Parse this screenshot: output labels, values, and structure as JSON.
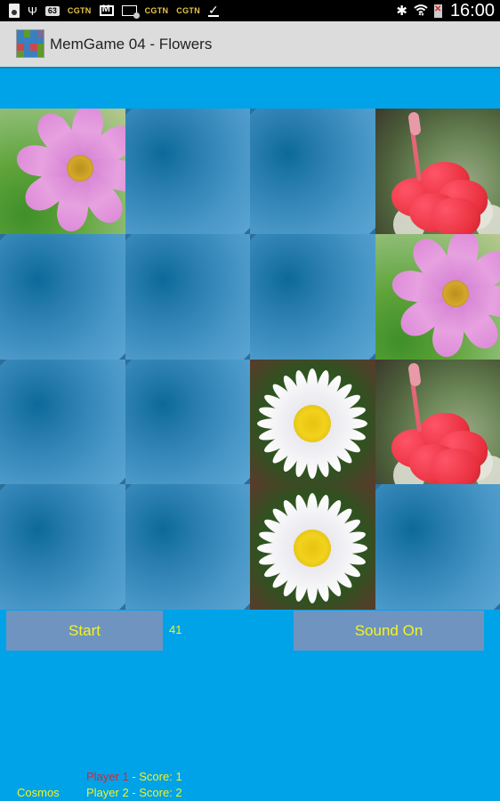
{
  "status_bar": {
    "left_icons": [
      "sd-card-icon",
      "usb-icon",
      "notification-count-icon",
      "cgtn-icon",
      "gmail-icon",
      "email-icon",
      "cgtn-icon",
      "cgtn-icon",
      "download-done-icon"
    ],
    "notification_count": "63",
    "cgtn_label": "CGTN",
    "right_icons": [
      "bluetooth-icon",
      "wifi-icon",
      "battery-alert-icon"
    ],
    "time": "16:00"
  },
  "action_bar": {
    "title": "MemGame 04 - Flowers"
  },
  "board": {
    "rows": 4,
    "cols": 4,
    "tiles": [
      {
        "state": "revealed",
        "image": "cosmos"
      },
      {
        "state": "hidden",
        "image": "card-back"
      },
      {
        "state": "hidden",
        "image": "card-back"
      },
      {
        "state": "revealed",
        "image": "hibiscus"
      },
      {
        "state": "hidden",
        "image": "card-back"
      },
      {
        "state": "hidden",
        "image": "card-back"
      },
      {
        "state": "hidden",
        "image": "card-back"
      },
      {
        "state": "revealed",
        "image": "cosmos"
      },
      {
        "state": "hidden",
        "image": "card-back"
      },
      {
        "state": "hidden",
        "image": "card-back"
      },
      {
        "state": "revealed",
        "image": "daisy"
      },
      {
        "state": "revealed",
        "image": "hibiscus"
      },
      {
        "state": "hidden",
        "image": "card-back"
      },
      {
        "state": "hidden",
        "image": "card-back"
      },
      {
        "state": "revealed",
        "image": "daisy"
      },
      {
        "state": "hidden",
        "image": "card-back"
      }
    ]
  },
  "controls": {
    "start_label": "Start",
    "counter": "41",
    "sound_label": "Sound On"
  },
  "footer": {
    "player1_name": "Player 1",
    "player1_score_text": " - Score: 1",
    "player2_text": "Player 2 - Score: 2",
    "last_flower": "Cosmos"
  },
  "colors": {
    "background": "#00a2e8",
    "action_bar": "#dcdcdc",
    "button_bg": "#7094c0",
    "button_text": "#f4f41e",
    "active_player": "#e4202a"
  }
}
